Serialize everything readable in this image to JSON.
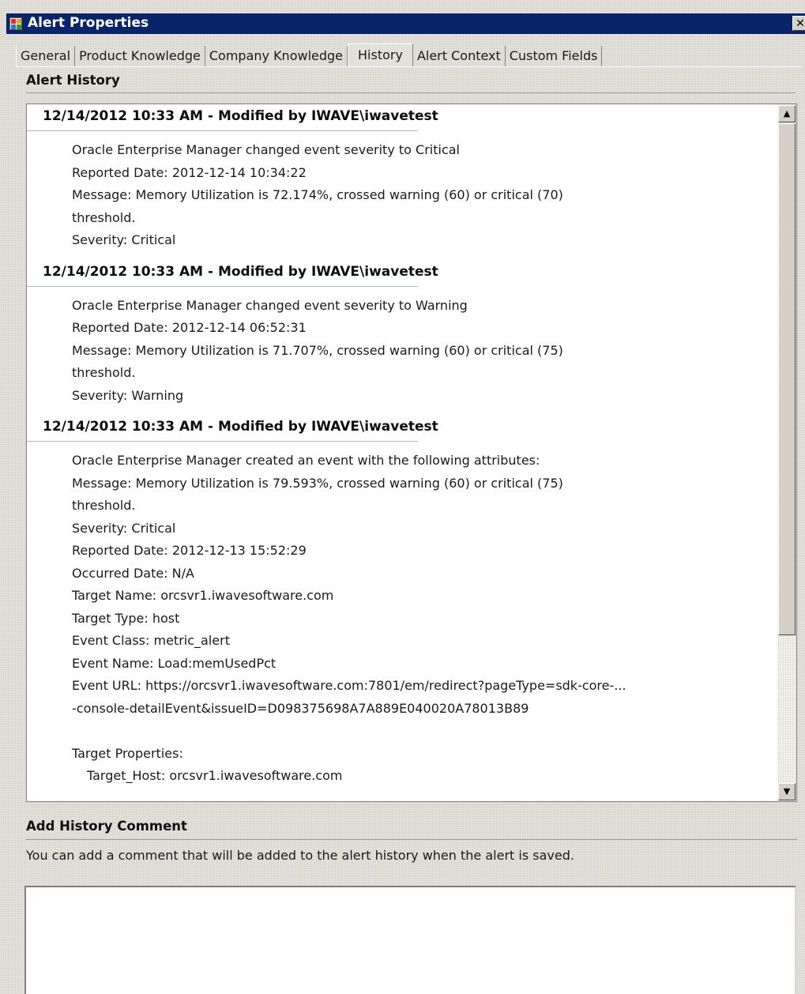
{
  "window": {
    "title": "Alert Properties",
    "close_glyph": "✕",
    "colors": {
      "titlebar": "#0a246a",
      "background": "#e4e1dc"
    }
  },
  "tabs": [
    {
      "label": "General",
      "active": false
    },
    {
      "label": "Product Knowledge",
      "active": false
    },
    {
      "label": "Company Knowledge",
      "active": false
    },
    {
      "label": "History",
      "active": true
    },
    {
      "label": "Alert Context",
      "active": false
    },
    {
      "label": "Custom Fields",
      "active": false
    }
  ],
  "alert_history": {
    "heading": "Alert History",
    "entries": [
      {
        "header": "12/14/2012 10:33 AM - Modified by IWAVE\\iwavetest",
        "lines": [
          "Oracle Enterprise Manager changed event severity to Critical",
          "Reported Date: 2012-12-14 10:34:22",
          "Message: Memory Utilization is 72.174%, crossed warning (60) or critical (70)",
          "threshold.",
          "Severity: Critical"
        ]
      },
      {
        "header": "12/14/2012 10:33 AM - Modified by IWAVE\\iwavetest",
        "lines": [
          "Oracle Enterprise Manager changed event severity to Warning",
          "Reported Date: 2012-12-14 06:52:31",
          "Message: Memory Utilization is 71.707%, crossed warning (60) or critical (75)",
          "threshold.",
          "Severity: Warning"
        ]
      },
      {
        "header": "12/14/2012 10:33 AM - Modified by IWAVE\\iwavetest",
        "lines": [
          "Oracle Enterprise Manager created an event with the following attributes:",
          "Message: Memory Utilization is 79.593%, crossed warning (60) or critical (75)",
          "threshold.",
          "Severity: Critical",
          "Reported Date: 2012-12-13 15:52:29",
          "Occurred Date: N/A",
          "Target Name: orcsvr1.iwavesoftware.com",
          "Target Type: host",
          "Event Class: metric_alert",
          "Event Name: Load:memUsedPct",
          "Event URL: https://orcsvr1.iwavesoftware.com:7801/em/redirect?pageType=sdk-core-...",
          "-console-detailEvent&issueID=D098375698A7A889E040020A78013B89",
          "",
          "Target Properties:"
        ],
        "sub_lines": [
          "Target_Host: orcsvr1.iwavesoftware.com"
        ]
      }
    ],
    "scroll_up_glyph": "▲",
    "scroll_down_glyph": "▼"
  },
  "add_comment": {
    "heading": "Add History Comment",
    "hint": "You can add a comment that will be added to the alert history when the alert is saved.",
    "value": ""
  }
}
